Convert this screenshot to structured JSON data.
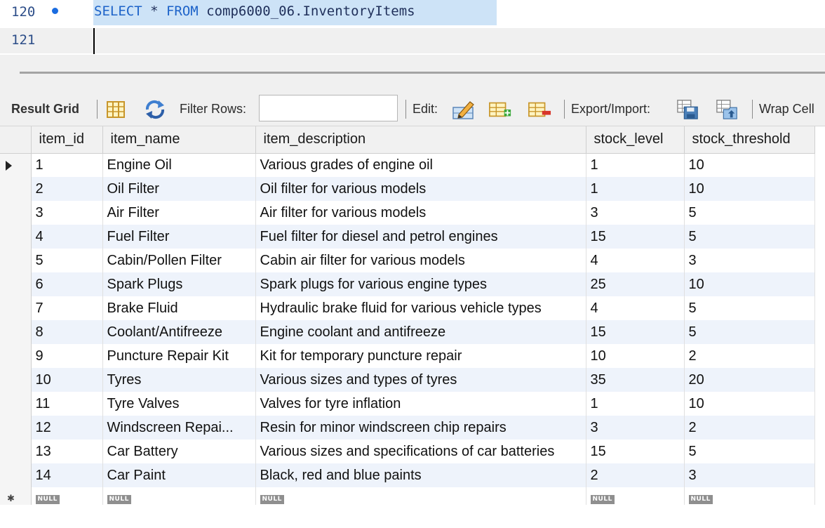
{
  "editor": {
    "lines": [
      {
        "number": "120",
        "keyword1": "SELECT",
        "middle": " * ",
        "keyword2": "FROM",
        "rest": " comp6000_06.InventoryItems"
      },
      {
        "number": "121"
      }
    ]
  },
  "toolbar": {
    "result_grid_label": "Result Grid",
    "filter_rows_label": "Filter Rows:",
    "filter_value": "",
    "edit_label": "Edit:",
    "export_import_label": "Export/Import:",
    "wrap_cell_label": "Wrap Cell"
  },
  "icons": {
    "form-editor": "grid-columns-icon",
    "refresh": "refresh-icon",
    "edit-cell": "pencil-icon",
    "insert-row": "add-row-icon",
    "delete-row": "delete-row-icon",
    "export": "save-disk-icon",
    "import": "import-icon"
  },
  "colors": {
    "keyword": "#1d63c9",
    "selection": "#cde3f7",
    "alt_row": "#eef3fb",
    "null_badge": "#8f8f8f"
  },
  "grid": {
    "columns": [
      "item_id",
      "item_name",
      "item_description",
      "stock_level",
      "stock_threshold"
    ],
    "rows": [
      [
        "1",
        "Engine Oil",
        "Various grades of engine oil",
        "1",
        "10"
      ],
      [
        "2",
        "Oil Filter",
        "Oil filter for various models",
        "1",
        "10"
      ],
      [
        "3",
        "Air Filter",
        "Air filter for various models",
        "3",
        "5"
      ],
      [
        "4",
        "Fuel Filter",
        "Fuel filter for diesel and petrol engines",
        "15",
        "5"
      ],
      [
        "5",
        "Cabin/Pollen Filter",
        "Cabin air filter for various models",
        "4",
        "3"
      ],
      [
        "6",
        "Spark Plugs",
        "Spark plugs for various engine types",
        "25",
        "10"
      ],
      [
        "7",
        "Brake Fluid",
        "Hydraulic brake fluid for various vehicle types",
        "4",
        "5"
      ],
      [
        "8",
        "Coolant/Antifreeze",
        "Engine coolant and antifreeze",
        "15",
        "5"
      ],
      [
        "9",
        "Puncture Repair Kit",
        "Kit for temporary puncture repair",
        "10",
        "2"
      ],
      [
        "10",
        "Tyres",
        "Various sizes and types of tyres",
        "35",
        "20"
      ],
      [
        "11",
        "Tyre Valves",
        "Valves for tyre inflation",
        "1",
        "10"
      ],
      [
        "12",
        "Windscreen Repai...",
        "Resin for minor windscreen chip repairs",
        "3",
        "2"
      ],
      [
        "13",
        "Car Battery",
        "Various sizes and specifications of car batteries",
        "15",
        "5"
      ],
      [
        "14",
        "Car Paint",
        "Black, red and blue paints",
        "2",
        "3"
      ]
    ],
    "null_label": "NULL"
  }
}
